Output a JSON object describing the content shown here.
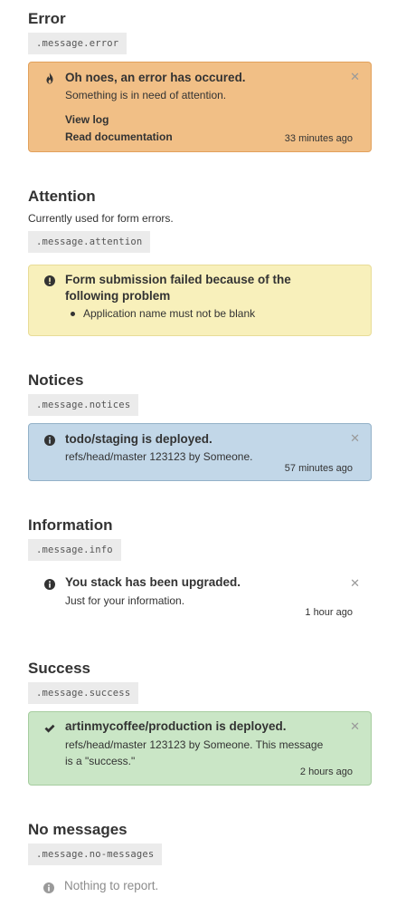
{
  "sections": {
    "error": {
      "title": "Error",
      "code": ".message.error",
      "message": {
        "icon": "fire-icon",
        "title": "Oh noes, an error has occured.",
        "body": "Something is in need of attention.",
        "links": [
          "View log",
          "Read documentation"
        ],
        "time": "33 minutes ago",
        "close": "✕"
      }
    },
    "attention": {
      "title": "Attention",
      "description": "Currently used for form errors.",
      "code": ".message.attention",
      "message": {
        "icon": "exclamation-circle-icon",
        "title_line1": "Form submission failed because of the",
        "title_line2": "following problem",
        "items": [
          "Application name must not be blank"
        ]
      }
    },
    "notices": {
      "title": "Notices",
      "code": ".message.notices",
      "message": {
        "icon": "info-circle-icon",
        "title": "todo/staging is deployed.",
        "body": "refs/head/master 123123 by Someone.",
        "time": "57 minutes ago",
        "close": "✕"
      }
    },
    "information": {
      "title": "Information",
      "code": ".message.info",
      "message": {
        "icon": "info-circle-icon",
        "title": "You stack has been upgraded.",
        "body": "Just for your information.",
        "time": "1 hour ago",
        "close": "✕"
      }
    },
    "success": {
      "title": "Success",
      "code": ".message.success",
      "message": {
        "icon": "checkmark-icon",
        "title": "artinmycoffee/production is deployed.",
        "body_line1": "refs/head/master 123123 by Someone. This message",
        "body_line2": "is a \"success.\"",
        "time": "2 hours ago",
        "close": "✕"
      }
    },
    "no_messages": {
      "title": "No messages",
      "code": ".message.no-messages",
      "message": {
        "icon": "info-circle-icon",
        "text": "Nothing to report."
      }
    }
  },
  "colors": {
    "error_bg": "#f1bf86",
    "attention_bg": "#f8f0bb",
    "notice_bg": "#c2d7e8",
    "success_bg": "#cae6c6",
    "code_bg": "#ebebeb"
  }
}
